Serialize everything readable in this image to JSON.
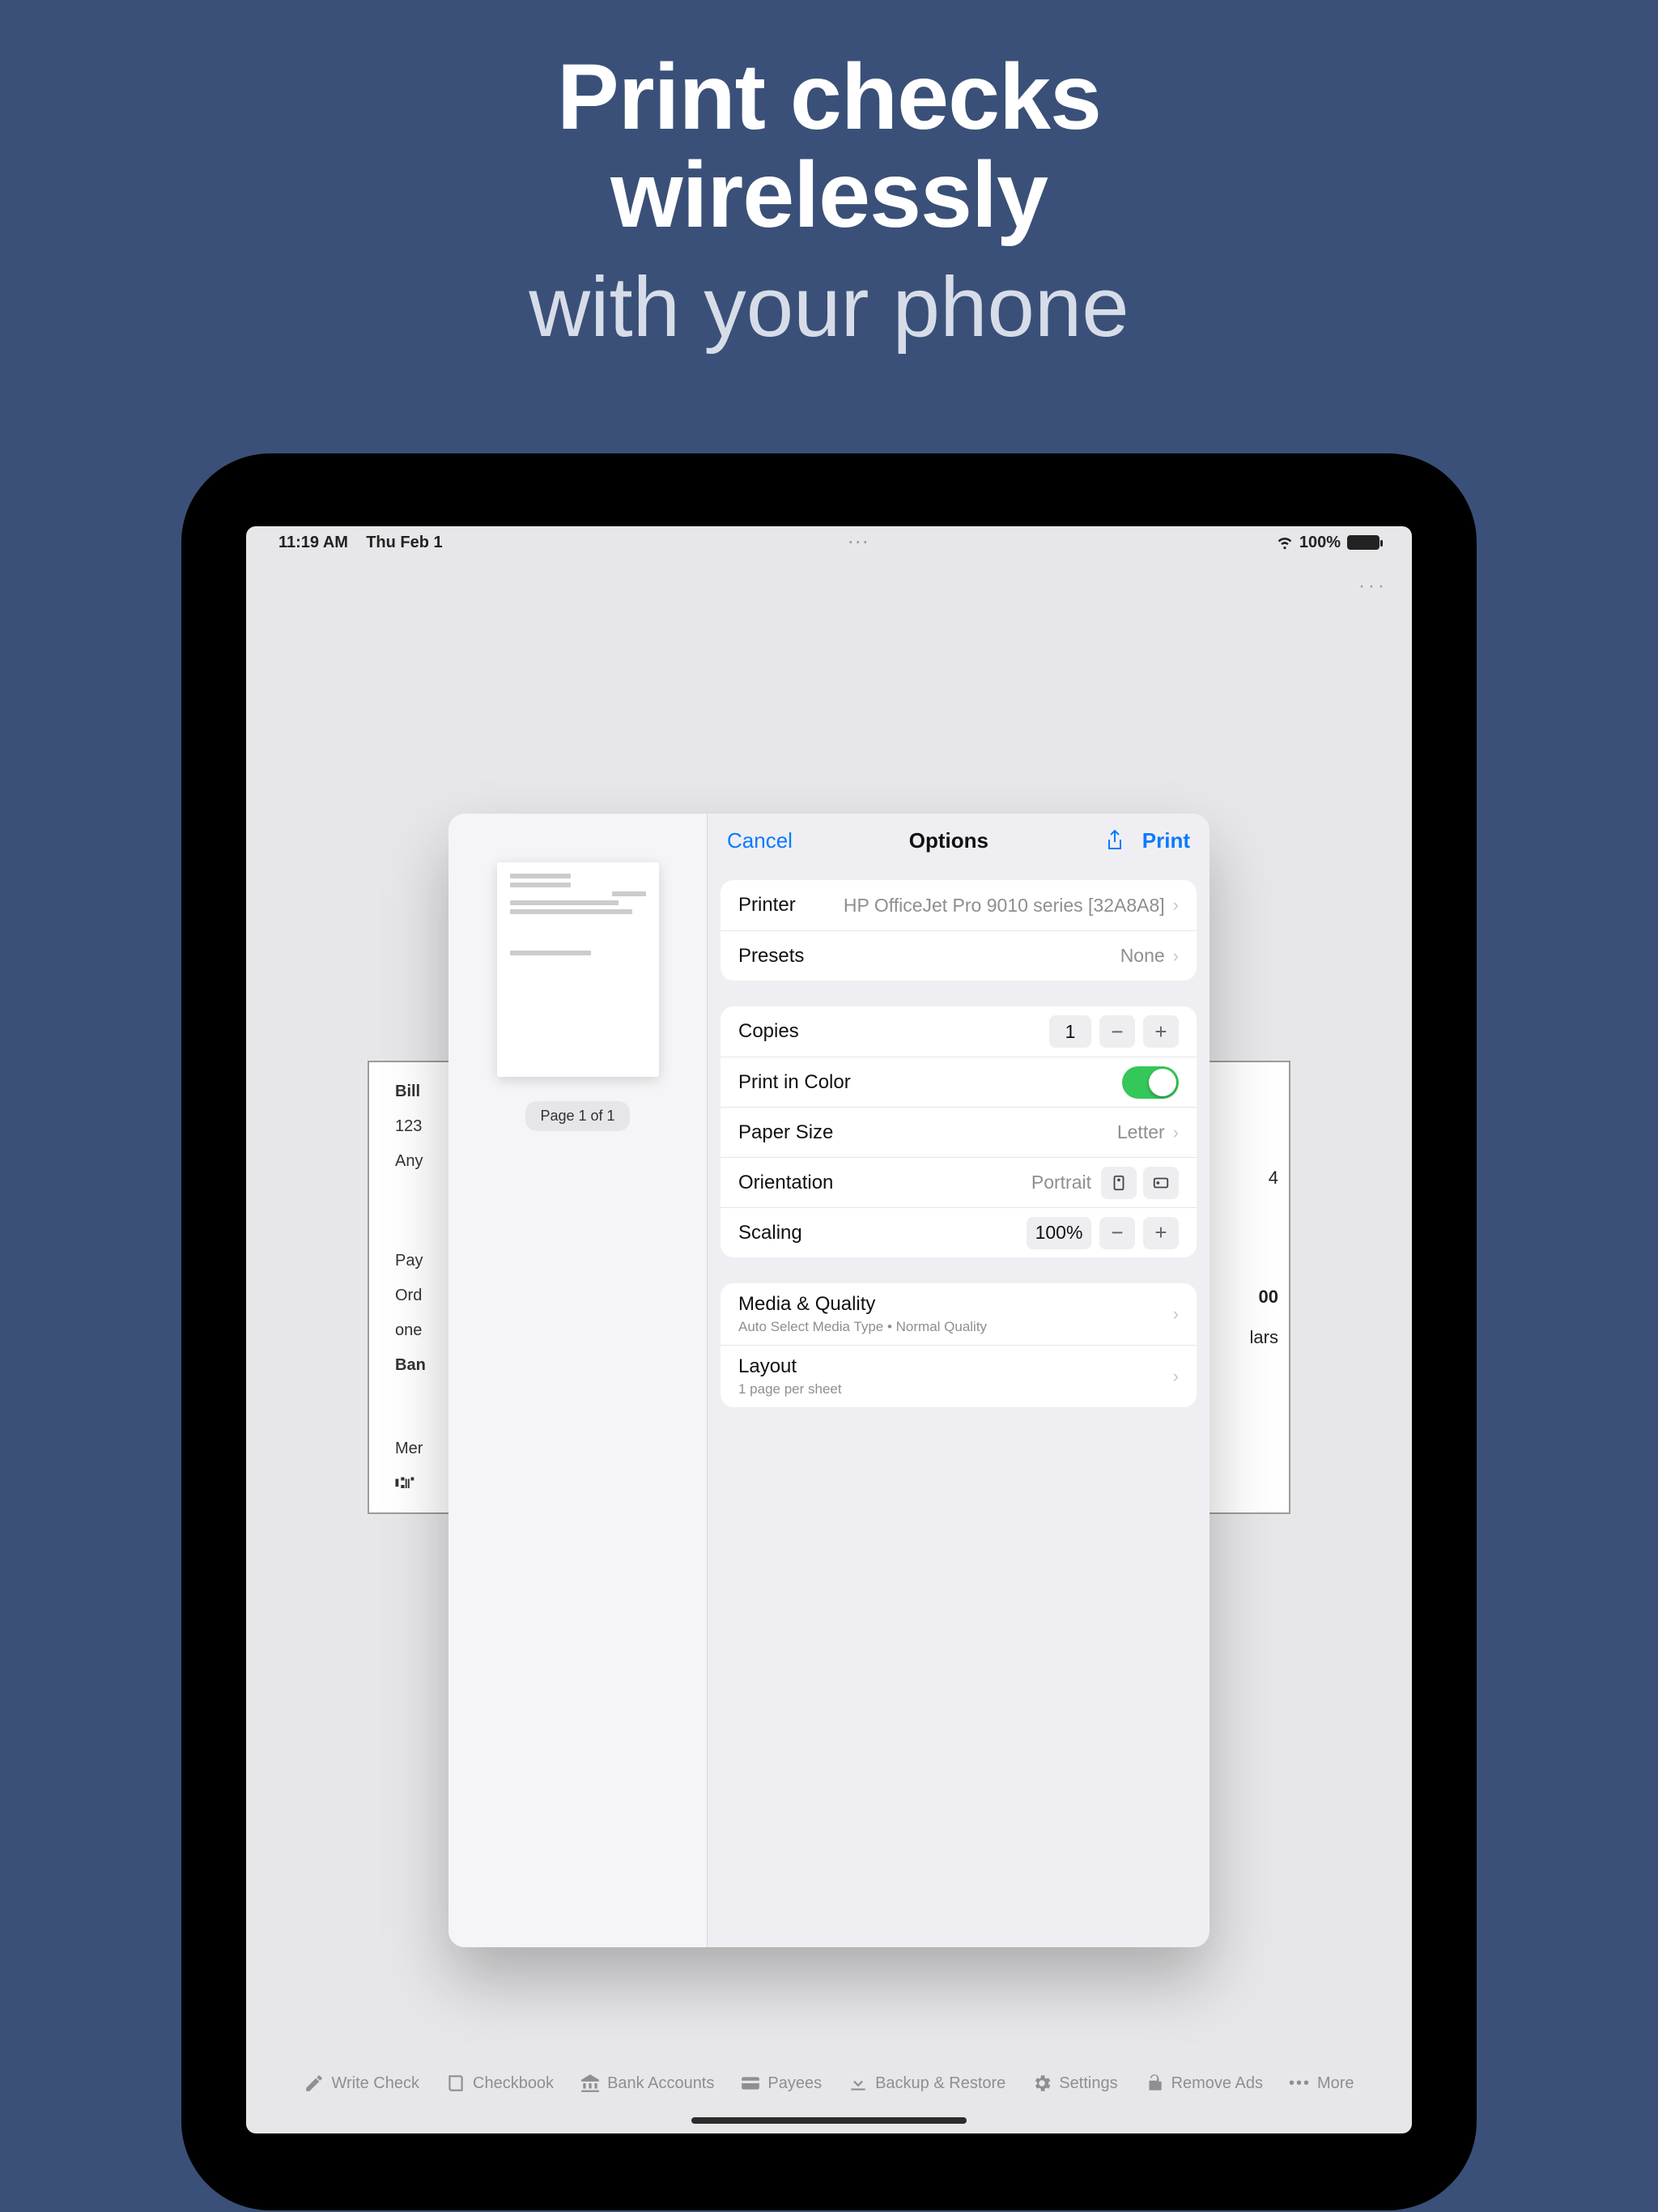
{
  "marketing": {
    "line1a": "Print checks",
    "line1b": "wirelessly",
    "line2": "with your phone"
  },
  "status": {
    "time": "11:19 AM",
    "date": "Thu Feb 1",
    "battery_pct": "100%"
  },
  "overflow_glyph": "···",
  "check_behind": {
    "line_bill": "Bill",
    "line_addr1": "123",
    "line_city": "Any",
    "line_pay": "Pay",
    "line_ord": "Ord",
    "line_one": "one",
    "line_bank": "Ban",
    "line_memo": "Mer",
    "line_micr": "⑆⑈"
  },
  "peek": {
    "p1": "4",
    "p2": "00",
    "p3": "lars"
  },
  "toolbar": {
    "write": "Write Check",
    "checkbook": "Checkbook",
    "bank": "Bank Accounts",
    "payees": "Payees",
    "backup": "Backup & Restore",
    "settings": "Settings",
    "remove_ads": "Remove Ads",
    "more": "More"
  },
  "print": {
    "cancel": "Cancel",
    "title": "Options",
    "print": "Print",
    "page_caption": "Page 1 of 1",
    "printer_label": "Printer",
    "printer_value": "HP OfficeJet Pro 9010 series [32A8A8]",
    "presets_label": "Presets",
    "presets_value": "None",
    "copies_label": "Copies",
    "copies_value": "1",
    "color_label": "Print in Color",
    "paper_label": "Paper Size",
    "paper_value": "Letter",
    "orient_label": "Orientation",
    "orient_value": "Portrait",
    "scaling_label": "Scaling",
    "scaling_value": "100%",
    "media_label": "Media & Quality",
    "media_sub": "Auto Select Media Type • Normal Quality",
    "layout_label": "Layout",
    "layout_sub": "1 page per sheet"
  }
}
